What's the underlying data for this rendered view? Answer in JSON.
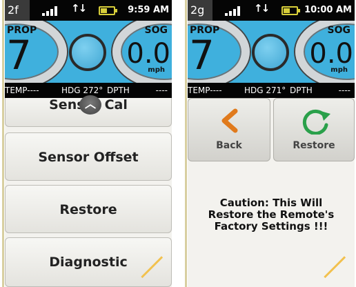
{
  "screens": [
    {
      "tag": "2f",
      "clock": "9:59 AM",
      "prop": {
        "label": "PROP",
        "value": "7"
      },
      "sog": {
        "label": "SOG",
        "value": "0.0",
        "unit": "mph"
      },
      "info": {
        "temp": "TEMP----",
        "hdg": "HDG 272°",
        "dpth": "DPTH",
        "dpth_value": "----"
      },
      "menu": {
        "items": [
          {
            "label": "Sensor Cal"
          },
          {
            "label": "Sensor Offset"
          },
          {
            "label": "Restore"
          },
          {
            "label": "Diagnostic"
          }
        ]
      }
    },
    {
      "tag": "2g",
      "clock": "10:00 AM",
      "prop": {
        "label": "PROP",
        "value": "7"
      },
      "sog": {
        "label": "SOG",
        "value": "0.0",
        "unit": "mph"
      },
      "info": {
        "temp": "TEMP----",
        "hdg": "HDG 271°",
        "dpth": "DPTH",
        "dpth_value": "----"
      },
      "toolbar": {
        "back_label": "Back",
        "restore_label": "Restore"
      },
      "caution": "Caution: This Will\nRestore the Remote's\nFactory Settings !!!"
    }
  ],
  "icons": {
    "signal": "signal-bars-icon",
    "data": "up-down-arrows-icon",
    "battery": "battery-icon",
    "scroll": "chevron-up-icon",
    "back": "chevron-left-icon",
    "restore": "refresh-icon"
  },
  "colors": {
    "gauge_bg": "#3fb0dd",
    "status_bg": "#050505",
    "back_icon": "#e07a1c",
    "restore_icon": "#2aa04a",
    "corner_accent": "#f2c14e"
  }
}
